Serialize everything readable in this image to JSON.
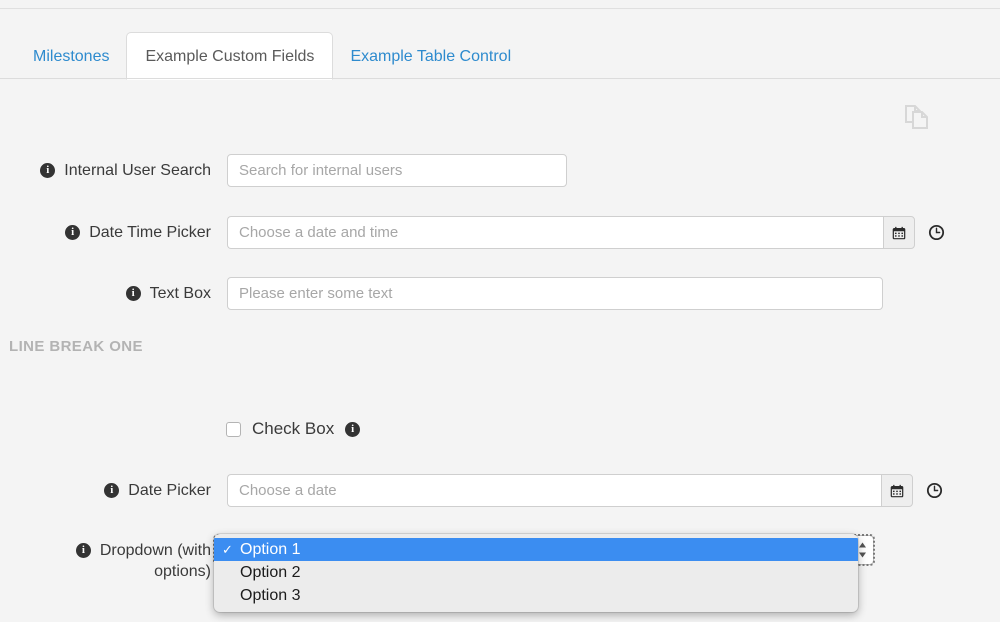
{
  "tabs": [
    {
      "label": "Milestones",
      "active": false
    },
    {
      "label": "Example Custom Fields",
      "active": true
    },
    {
      "label": "Example Table Control",
      "active": false
    }
  ],
  "toolbar": {
    "copy_icon": "copy-icon"
  },
  "form": {
    "internal_user_search": {
      "label": "Internal User Search",
      "placeholder": "Search for internal users",
      "value": "",
      "info_icon": "info-icon"
    },
    "date_time_picker": {
      "label": "Date Time Picker",
      "placeholder": "Choose a date and time",
      "value": "",
      "info_icon": "info-icon",
      "calendar_icon": "calendar-icon",
      "clock_icon": "clock-icon"
    },
    "text_box": {
      "label": "Text Box",
      "placeholder": "Please enter some text",
      "value": "",
      "info_icon": "info-icon"
    },
    "section_break": "LINE BREAK ONE",
    "check_box": {
      "label": "Check Box",
      "checked": false,
      "info_icon": "info-icon"
    },
    "date_picker": {
      "label": "Date Picker",
      "placeholder": "Choose a date",
      "value": "",
      "info_icon": "info-icon",
      "calendar_icon": "calendar-icon",
      "clock_icon": "clock-icon"
    },
    "dropdown": {
      "label": "Dropdown (with\noptions)",
      "info_icon": "info-icon",
      "selected": "Option 1",
      "options": [
        "Option 1",
        "Option 2",
        "Option 3"
      ],
      "check_glyph": "✓",
      "expanded": true
    }
  },
  "colors": {
    "page_background": "#f4f4f4",
    "tab_link": "#2e8bce",
    "tab_active_text": "#5a5a5a",
    "label_text": "#3a3a3a",
    "placeholder": "#a7a7a7",
    "section_break_text": "#b3b3b3",
    "menu_highlight": "#3b8df1",
    "info_icon_background": "#333333"
  }
}
